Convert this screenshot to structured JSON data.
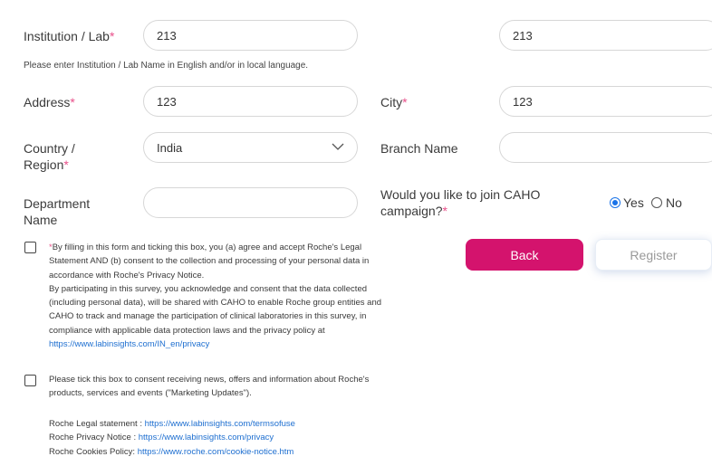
{
  "form": {
    "institution": {
      "label": "Institution / Lab",
      "value": "213",
      "value_local": "213",
      "hint": "Please enter Institution / Lab Name in English and/or in local language."
    },
    "address": {
      "label": "Address",
      "value": "123"
    },
    "city": {
      "label": "City",
      "value": "123"
    },
    "country": {
      "label_line1": "Country /",
      "label_line2": "Region",
      "value": "India"
    },
    "branch": {
      "label": "Branch Name",
      "value": ""
    },
    "department": {
      "label_line1": "Department",
      "label_line2": "Name",
      "value": ""
    },
    "caho": {
      "label_line1": "Would you like to join CAHO",
      "label_line2": "campaign?",
      "yes": "Yes",
      "no": "No",
      "selected": "Yes"
    },
    "required_mark": "*"
  },
  "consent": {
    "legal_lines": [
      "By filling in this form and ticking this box, you (a) agree and accept Roche's Legal",
      "Statement AND (b) consent to the collection and processing of your personal data in",
      "accordance with Roche's Privacy Notice.",
      "By participating in this survey, you acknowledge and consent that the data collected",
      "(including personal data), will be shared with CAHO to enable Roche group entities and",
      "CAHO to track and manage the participation of clinical laboratories in this survey, in",
      "compliance with applicable data protection laws and the privacy policy at"
    ],
    "legal_link": "https://www.labinsights.com/IN_en/privacy",
    "marketing_lines": [
      "Please tick this box to consent receiving news, offers and information about Roche's",
      "products, services and events (\"Marketing Updates\")."
    ]
  },
  "policies": [
    {
      "label": "Roche Legal statement : ",
      "url": "https://www.labinsights.com/termsofuse"
    },
    {
      "label": "Roche Privacy Notice : ",
      "url": "https://www.labinsights.com/privacy"
    },
    {
      "label": "Roche Cookies Policy: ",
      "url": "https://www.roche.com/cookie-notice.htm"
    }
  ],
  "buttons": {
    "back": "Back",
    "register": "Register"
  },
  "colors": {
    "accent": "#d4136d",
    "link": "#1e6fd0",
    "required": "#e8508a",
    "radio": "#1a73e8"
  }
}
